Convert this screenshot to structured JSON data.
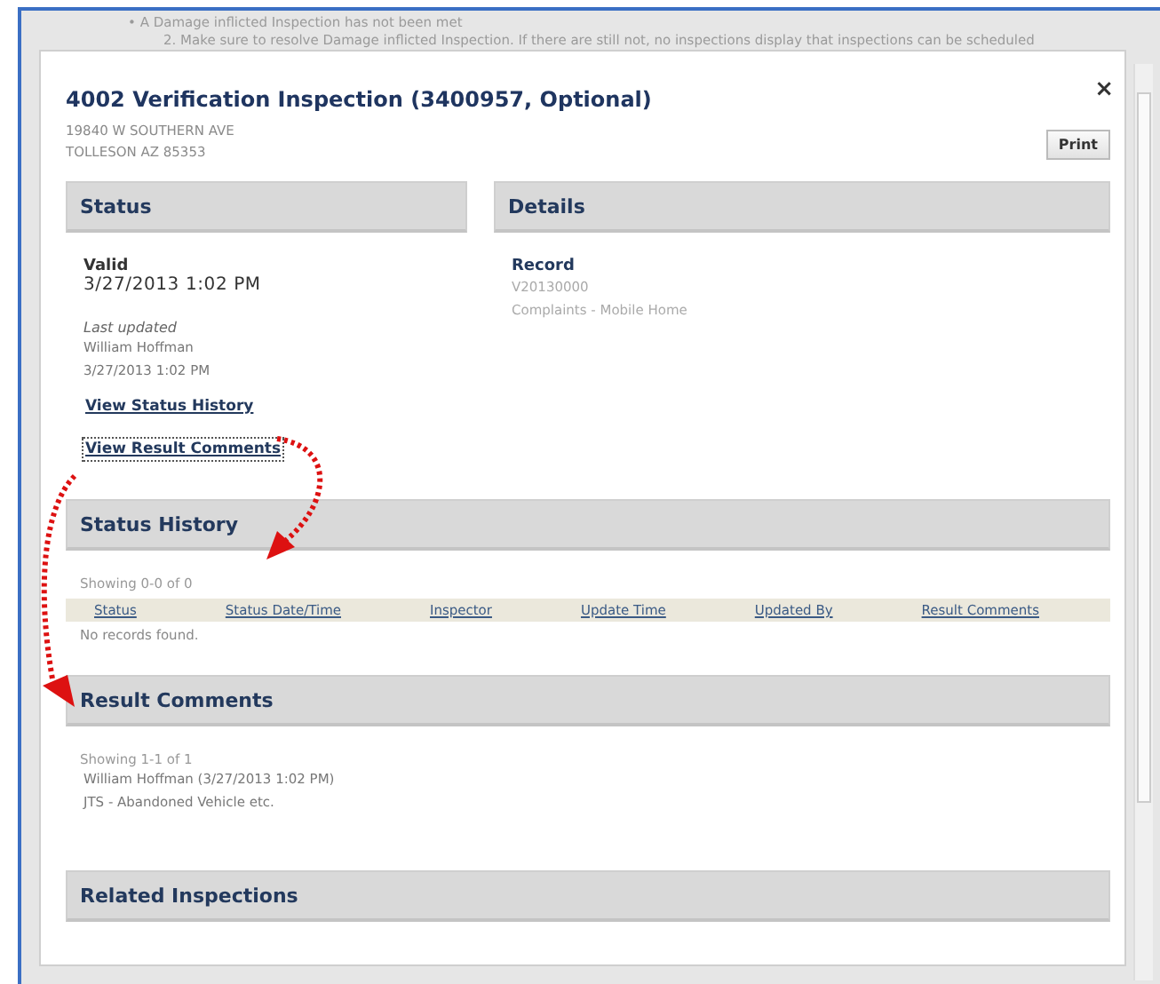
{
  "background_lines": [
    {
      "bullet": "•",
      "text": "A Damage inflicted Inspection has not been met"
    },
    {
      "bullet": "2.",
      "text": "Make sure to resolve Damage inflicted Inspection. If there are still not, no inspections display that inspections can be scheduled"
    }
  ],
  "dialog": {
    "close": "×",
    "title": "4002 Verification Inspection (3400957, Optional)",
    "address": [
      "19840 W SOUTHERN AVE",
      "TOLLESON AZ 85353"
    ],
    "print_button": "Print",
    "status": {
      "heading": "Status",
      "value": "Valid",
      "date": "3/27/2013 1:02 PM",
      "last_updated_label": "Last updated",
      "updated_by": "William Hoffman",
      "updated_date": "3/27/2013 1:02 PM",
      "links": [
        {
          "label": "View Status History",
          "focused": false
        },
        {
          "label": "View Result Comments",
          "focused": true
        }
      ]
    },
    "details": {
      "heading": "Details",
      "record_label": "Record",
      "record_id": "V20130000",
      "record_type": "Complaints - Mobile Home"
    },
    "status_history": {
      "heading": "Status History",
      "showing": "Showing 0-0 of 0",
      "columns": [
        "Status",
        "Status Date/Time",
        "Inspector",
        "Update Time",
        "Updated By",
        "Result Comments"
      ],
      "empty": "No records found."
    },
    "result_comments": {
      "heading": "Result Comments",
      "showing": "Showing 1-1 of 1",
      "comments": [
        {
          "author": "William Hoffman (3/27/2013 1:02 PM)",
          "text": "JTS - Abandoned Vehicle etc."
        }
      ]
    },
    "related": {
      "heading": "Related Inspections"
    }
  }
}
